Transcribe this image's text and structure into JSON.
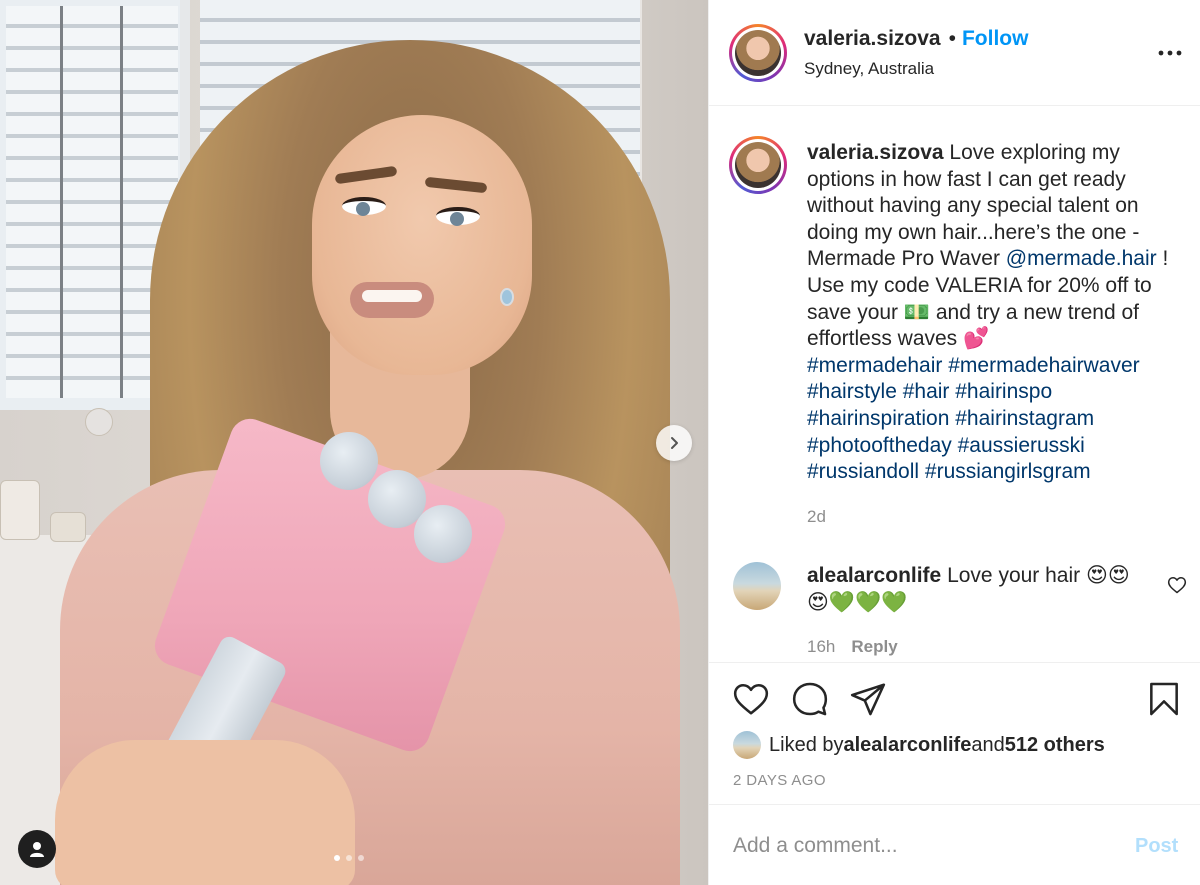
{
  "post": {
    "username": "valeria.sizova",
    "separator": "•",
    "follow_label": "Follow",
    "location": "Sydney, Australia"
  },
  "caption": {
    "username": "valeria.sizova",
    "text_1": " Love exploring my options in how fast I can get ready without having any special talent on doing my own hair...here’s the one - Mermade Pro Waver ",
    "mention": "@mermade.hair",
    "text_2": " ! Use my code VALERIA for 20% off to save your 💵 and try a new trend of effortless waves 💕",
    "hashtags": "#mermadehair #mermadehairwaver #hairstyle #hair #hairinspo #hairinspiration #hairinstagram #photooftheday #aussierusski #russiandoll #russiangirlsgram",
    "time_ago": "2d"
  },
  "comments": [
    {
      "username": "alealarconlife",
      "text": " Love your hair 😍😍😍💚💚💚",
      "time": "16h",
      "reply_label": "Reply"
    }
  ],
  "likes": {
    "prefix": "Liked by ",
    "user": "alealarconlife",
    "middle": " and ",
    "others": "512 others"
  },
  "date_label": "2 DAYS AGO",
  "add_comment": {
    "placeholder": "Add a comment...",
    "post_label": "Post"
  },
  "carousel": {
    "slide_count": 3,
    "active_slide": 1
  },
  "colors": {
    "link_blue": "#0095f6",
    "hashtag_blue": "#00376b",
    "muted_gray": "#8e8e8e",
    "post_disabled": "#b2dffc"
  }
}
